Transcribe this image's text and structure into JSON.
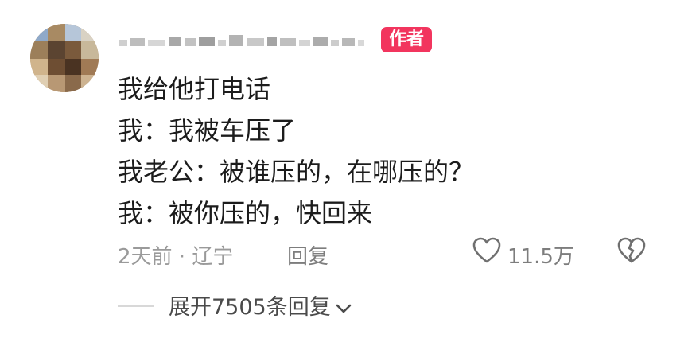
{
  "comment": {
    "author_badge": "作者",
    "lines": [
      "我给他打电话",
      "我：我被车压了",
      "我老公：被谁压的，在哪压的？",
      "我：被你压的，快回来"
    ],
    "time_location": "2天前 · 辽宁",
    "reply_label": "回复",
    "like_count": "11.5万",
    "expand_replies_label": "展开7505条回复"
  },
  "icons": {
    "avatar": "pixelated-avatar",
    "username": "pixelated-username",
    "like": "heart-outline-icon",
    "dislike": "broken-heart-icon",
    "expand": "chevron-down-icon"
  },
  "colors": {
    "badge_bg": "#f2355e",
    "badge_text": "#ffffff",
    "meta_text": "#9a9a9a",
    "icon": "#6f6f6f"
  }
}
